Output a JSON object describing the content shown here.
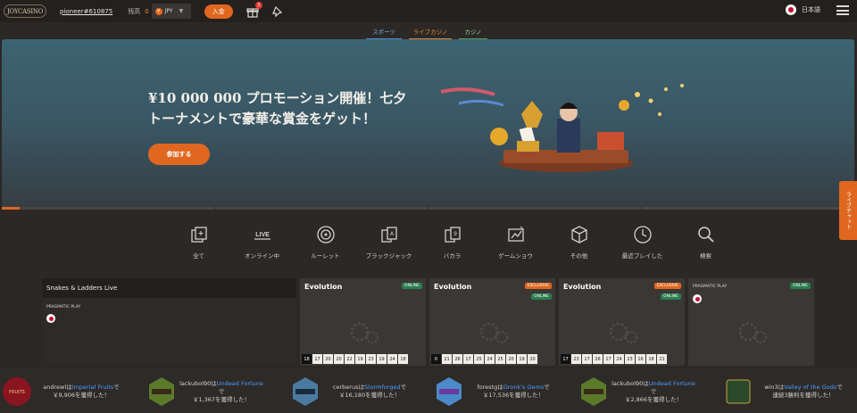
{
  "header": {
    "logo": "JOYCASINO",
    "username": "pioneer#610875",
    "balance_label": "残高",
    "balance_value": "0",
    "currency_symbol": "¥",
    "currency": "JPY",
    "deposit_label": "入金",
    "gift_badge": "3",
    "language": "日本語"
  },
  "tabs": [
    "スポーツ",
    "ライブカジノ",
    "カジノ"
  ],
  "banner": {
    "title": "¥10 000 000 プロモーション開催！七夕トーナメントで豪華な賞金をゲット！",
    "cta": "参加する"
  },
  "live_chat": "ライブチャット",
  "categories": [
    {
      "label": "全て",
      "icon": "all-games-icon"
    },
    {
      "label": "オンライン中",
      "icon": "live-icon",
      "icon_text": "LIVE"
    },
    {
      "label": "ルーレット",
      "icon": "roulette-icon"
    },
    {
      "label": "ブラックジャック",
      "icon": "blackjack-icon"
    },
    {
      "label": "バカラ",
      "icon": "baccarat-icon"
    },
    {
      "label": "ゲームショウ",
      "icon": "game-show-icon"
    },
    {
      "label": "その他",
      "icon": "dice-icon"
    },
    {
      "label": "最近プレイした",
      "icon": "recent-icon"
    },
    {
      "label": "検索",
      "icon": "search-icon"
    }
  ],
  "games": [
    {
      "title": "Snakes & Ladders Live",
      "provider": "PRAGMATIC PLAY"
    },
    {
      "provider": "Evolution",
      "online": "ONLINE",
      "numbers": [
        "18",
        "17",
        "20",
        "20",
        "22",
        "19",
        "23",
        "19",
        "24",
        "18"
      ]
    },
    {
      "provider": "Evolution",
      "exclusive": "EXCLUSIVE",
      "online": "ONLINE",
      "numbers": [
        "0",
        "21",
        "26",
        "17",
        "25",
        "24",
        "25",
        "20",
        "19",
        "20"
      ]
    },
    {
      "provider": "Evolution",
      "exclusive": "EXCLUSIVE",
      "online": "ONLINE",
      "numbers": [
        "17",
        "23",
        "17",
        "26",
        "17",
        "24",
        "23",
        "16",
        "18",
        "21"
      ]
    },
    {
      "provider": "PRAGMATIC PLAY",
      "online": "ONLINE"
    }
  ],
  "winners": [
    {
      "user": "andrewl",
      "game": "Imperial Fruits",
      "amount": "￥9,906を獲得した！"
    },
    {
      "user": "lackubol90",
      "game": "Undead Fortune",
      "amount": "￥1,367を獲得した！"
    },
    {
      "user": "cerberus",
      "game": "Stormforged",
      "amount": "￥16,180を獲得した！"
    },
    {
      "user": "forestg",
      "game": "Gronk's Gems",
      "amount": "￥17,536を獲得した！"
    },
    {
      "user": "lackubol90",
      "game": "Undead Fortune",
      "amount": "￥2,866を獲得した！"
    },
    {
      "user": "win3",
      "game": "Valley of the Gods",
      "amount": "連続3勝利を獲得した！"
    }
  ]
}
